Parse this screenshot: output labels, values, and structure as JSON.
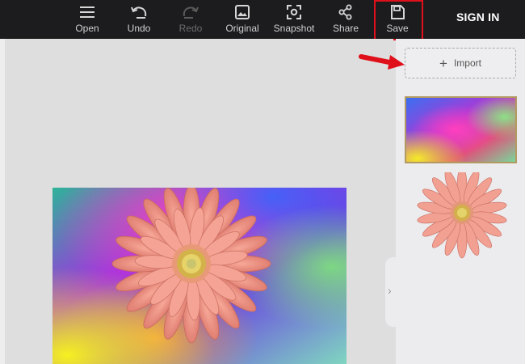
{
  "toolbar": {
    "items": [
      {
        "label": "Open",
        "icon": "hamburger-menu-icon",
        "enabled": true
      },
      {
        "label": "Undo",
        "icon": "undo-icon",
        "enabled": true
      },
      {
        "label": "Redo",
        "icon": "redo-icon",
        "enabled": false
      },
      {
        "label": "Original",
        "icon": "image-icon",
        "enabled": true
      },
      {
        "label": "Snapshot",
        "icon": "snapshot-icon",
        "enabled": true
      },
      {
        "label": "Share",
        "icon": "share-icon",
        "enabled": true
      },
      {
        "label": "Save",
        "icon": "save-icon",
        "enabled": true
      }
    ],
    "sign_in": "SIGN IN",
    "highlight_color": "#e0101a"
  },
  "sidepanel": {
    "import_label": "Import",
    "thumbnails": [
      {
        "kind": "rainbow-background"
      },
      {
        "kind": "pink-gerbera-flower"
      }
    ]
  },
  "annotation": {
    "arrow_color": "#e0101a",
    "points_to": "Import"
  },
  "colors": {
    "toolbar_bg": "#1c1c1e",
    "canvas_bg": "#dedede",
    "panel_bg": "#ececee"
  }
}
